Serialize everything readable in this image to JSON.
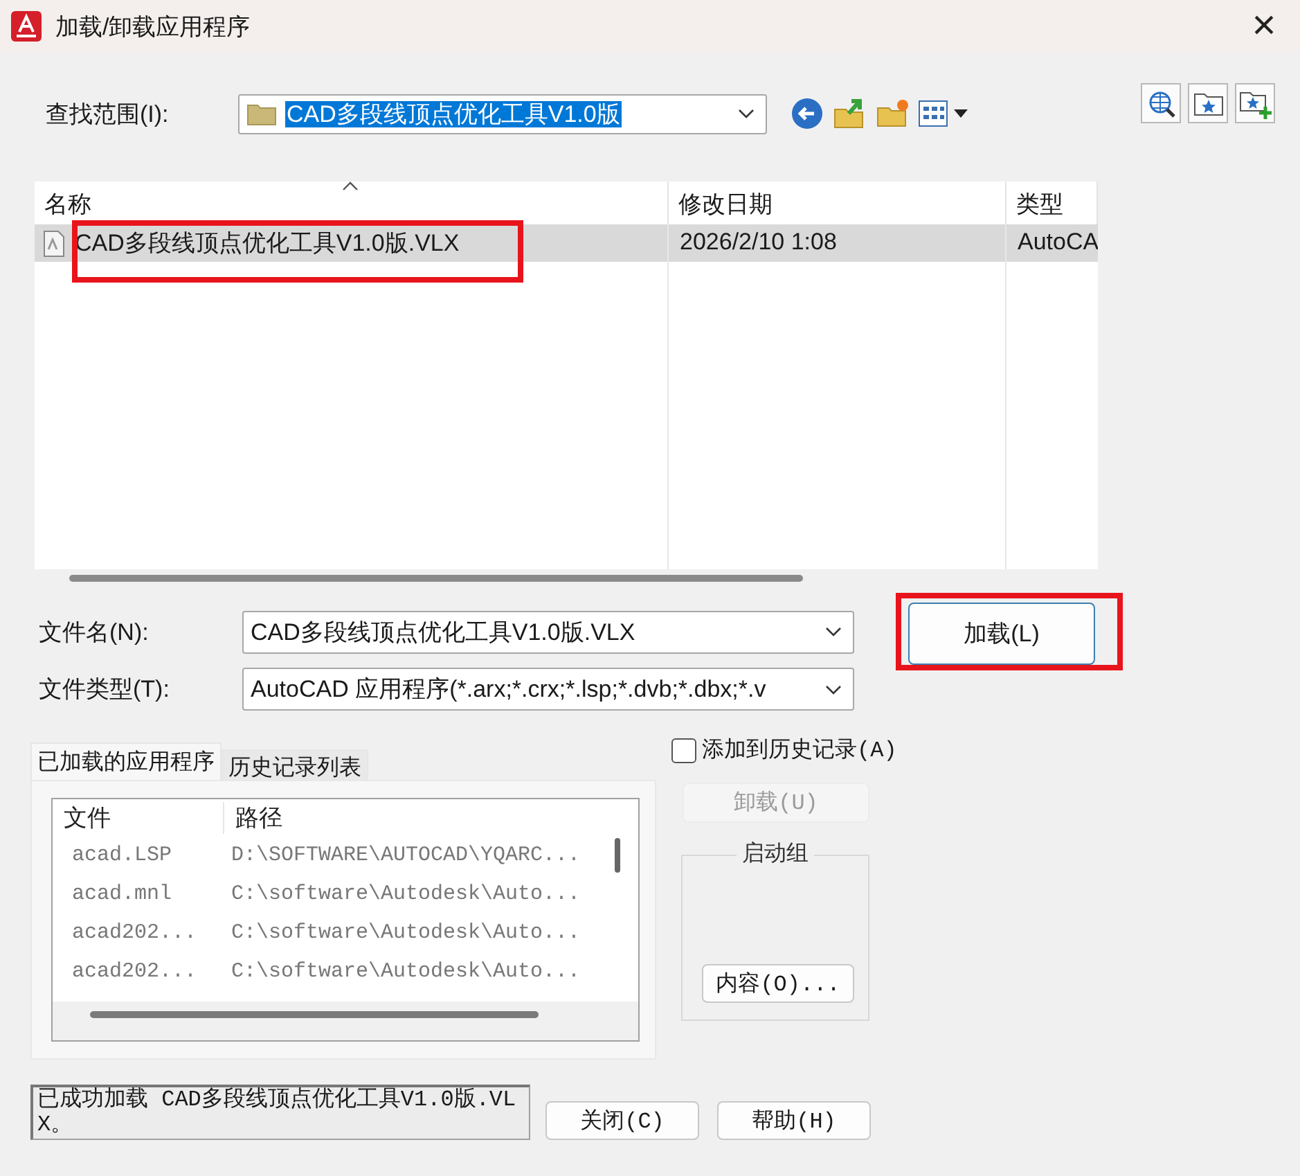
{
  "window": {
    "title": "加载/卸载应用程序",
    "close": "×"
  },
  "look_in": {
    "label": "查找范围(I):",
    "value": "CAD多段线顶点优化工具V1.0版"
  },
  "file_list": {
    "columns": [
      {
        "label": "名称",
        "sorted": true
      },
      {
        "label": "修改日期",
        "sorted": false
      },
      {
        "label": "类型",
        "sorted": false
      }
    ],
    "rows": [
      {
        "name": "CAD多段线顶点优化工具V1.0版.VLX",
        "modified": "2026/2/10 1:08",
        "type": "AutoCA",
        "selected": true,
        "annotated": true
      }
    ]
  },
  "file_name": {
    "label": "文件名(N):",
    "value": "CAD多段线顶点优化工具V1.0版.VLX"
  },
  "file_type": {
    "label": "文件类型(T):",
    "value": "AutoCAD 应用程序(*.arx;*.crx;*.lsp;*.dvb;*.dbx;*.v"
  },
  "load_button": {
    "label": "加载(L)",
    "annotated": true
  },
  "tabs": [
    {
      "label": "已加载的应用程序",
      "selected": true
    },
    {
      "label": "历史记录列表",
      "selected": false
    }
  ],
  "loaded_apps": {
    "columns": [
      "文件",
      "路径"
    ],
    "rows": [
      {
        "file": "acad.LSP",
        "path": "D:\\SOFTWARE\\AUTOCAD\\YQARC..."
      },
      {
        "file": "acad.mnl",
        "path": "C:\\software\\Autodesk\\Auto..."
      },
      {
        "file": "acad202...",
        "path": "C:\\software\\Autodesk\\Auto..."
      },
      {
        "file": "acad202...",
        "path": "C:\\software\\Autodesk\\Auto..."
      }
    ]
  },
  "add_to_history": {
    "label": "添加到历史记录(A)",
    "checked": false
  },
  "unload_button": {
    "label": "卸载(U)",
    "disabled": true
  },
  "startup_suite": {
    "title": "启动组",
    "button": "内容(O)..."
  },
  "status": "已成功加载 CAD多段线顶点优化工具V1.0版.VLX。",
  "buttons": [
    {
      "label": "关闭(C)"
    },
    {
      "label": "帮助(H)"
    }
  ]
}
